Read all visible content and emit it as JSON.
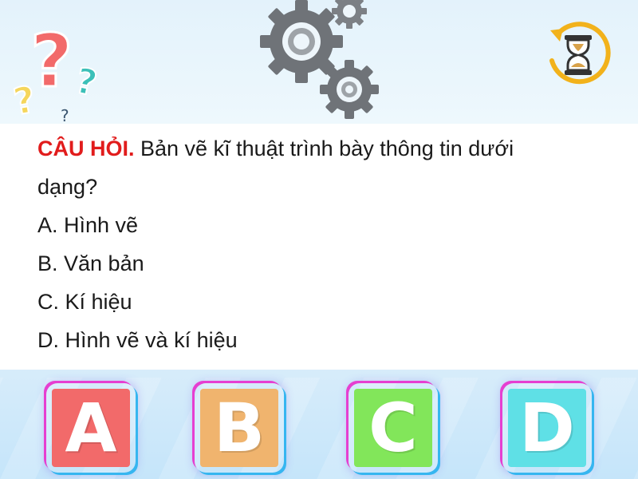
{
  "question": {
    "label": "CÂU HỎI.",
    "text_line1": "Bản vẽ kĩ thuật trình bày thông tin dưới",
    "text_line2": "dạng?"
  },
  "options": [
    {
      "text": "A. Hình vẽ"
    },
    {
      "text": "B. Văn bản"
    },
    {
      "text": "C. Kí hiệu"
    },
    {
      "text": "D. Hình vẽ và kí hiệu"
    }
  ],
  "answer_buttons": [
    {
      "letter": "A",
      "color": "#f26a6a"
    },
    {
      "letter": "B",
      "color": "#f0b46e"
    },
    {
      "letter": "C",
      "color": "#82e65a"
    },
    {
      "letter": "D",
      "color": "#5fe0e6"
    }
  ],
  "decor": {
    "question_marks_icon": "question-marks-icon",
    "gears_icon": "gears-icon",
    "timer_icon": "hourglass-timer-icon"
  },
  "colors": {
    "label_red": "#e11c1c",
    "gear_gray": "#6f7378",
    "timer_ring": "#f2b21b"
  }
}
